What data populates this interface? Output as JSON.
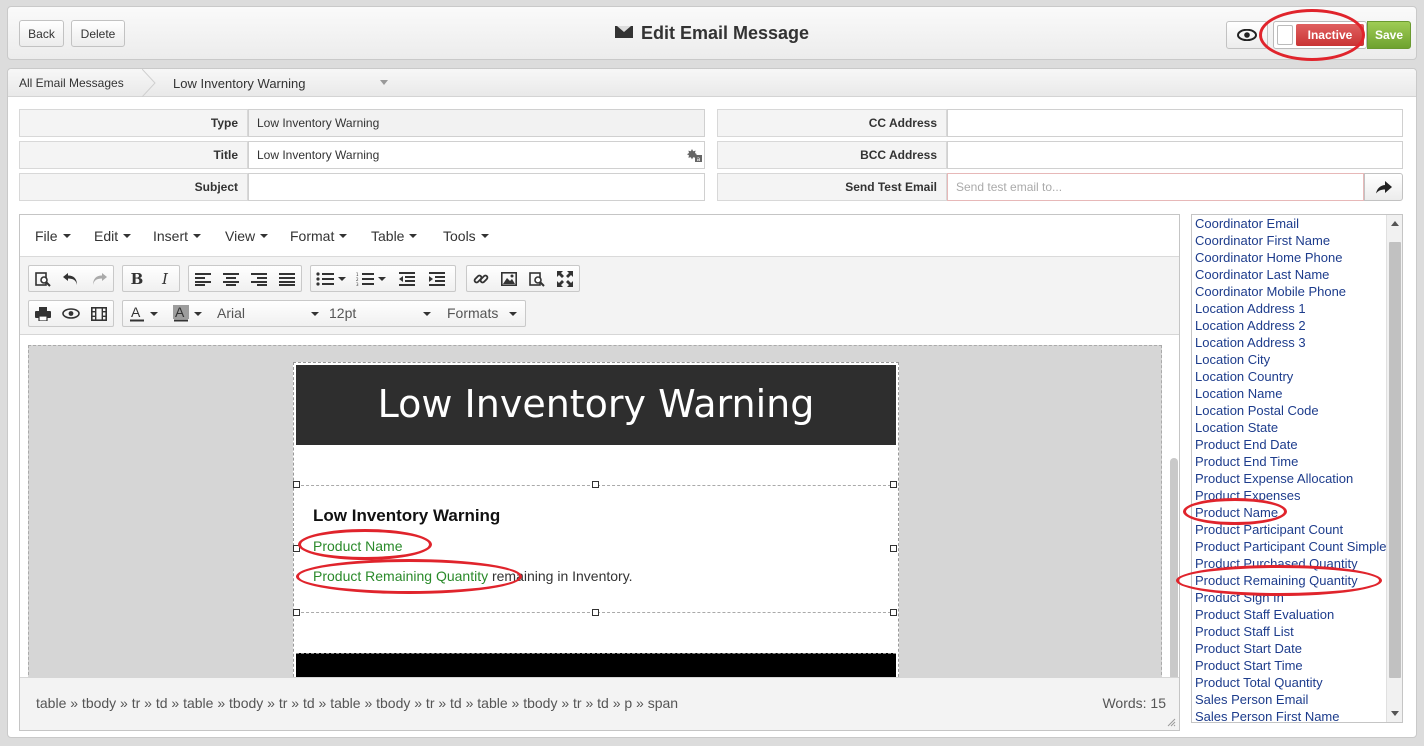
{
  "header": {
    "back_label": "Back",
    "delete_label": "Delete",
    "title": "Edit Email Message",
    "status_label": "Inactive",
    "save_label": "Save"
  },
  "breadcrumb": {
    "parent": "All Email Messages",
    "current": "Low Inventory Warning"
  },
  "form": {
    "type_label": "Type",
    "type_value": "Low Inventory Warning",
    "title_label": "Title",
    "title_value": "Low Inventory Warning",
    "subject_label": "Subject",
    "subject_value": "",
    "cc_label": "CC Address",
    "cc_value": "",
    "bcc_label": "BCC Address",
    "bcc_value": "",
    "test_label": "Send Test Email",
    "test_placeholder": "Send test email to..."
  },
  "editor": {
    "menus": [
      "File",
      "Edit",
      "Insert",
      "View",
      "Format",
      "Table",
      "Tools"
    ],
    "font_family": "Arial",
    "font_size": "12pt",
    "formats_label": "Formats",
    "email": {
      "banner": "Low Inventory Warning",
      "heading": "Low Inventory Warning",
      "field_product_name": "Product Name",
      "field_remaining_qty": "Product Remaining Quantity",
      "line2_suffix": " remaining in Inventory."
    },
    "element_path": "table » tbody » tr » td » table » tbody » tr » td » table » tbody » tr » td » table » tbody » tr » td » p » span",
    "word_count": "Words: 15"
  },
  "merge_fields": [
    "Coordinator Email",
    "Coordinator First Name",
    "Coordinator Home Phone",
    "Coordinator Last Name",
    "Coordinator Mobile Phone",
    "Location Address 1",
    "Location Address 2",
    "Location Address 3",
    "Location City",
    "Location Country",
    "Location Name",
    "Location Postal Code",
    "Location State",
    "Product End Date",
    "Product End Time",
    "Product Expense Allocation",
    "Product Expenses",
    "Product Name",
    "Product Participant Count",
    "Product Participant Count Simple",
    "Product Purchased Quantity",
    "Product Remaining Quantity",
    "Product Sign In",
    "Product Staff Evaluation",
    "Product Staff List",
    "Product Start Date",
    "Product Start Time",
    "Product Total Quantity",
    "Sales Person Email",
    "Sales Person First Name"
  ],
  "colors": {
    "inactive": "#c93434",
    "save": "#7eb03a",
    "highlight": "#e0242c",
    "merge_field": "#2a8a2a"
  }
}
